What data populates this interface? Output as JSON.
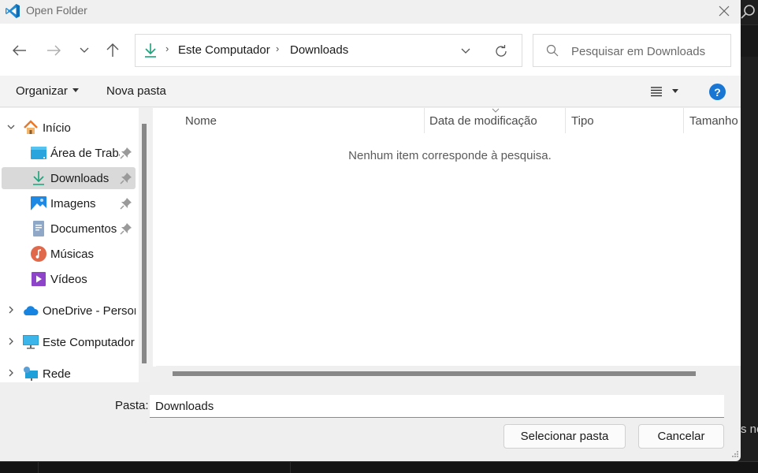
{
  "window": {
    "title": "Open Folder",
    "close_icon": "close-icon"
  },
  "navigation": {
    "back_icon": "arrow-left-icon",
    "forward_icon": "arrow-right-icon",
    "recent_icon": "chevron-down-icon",
    "up_icon": "arrow-up-icon",
    "breadcrumb": [
      {
        "label": "Este Computador"
      },
      {
        "label": "Downloads"
      }
    ],
    "breadcrumb_icon": "download-icon",
    "refresh_icon": "refresh-icon",
    "search_placeholder": "Pesquisar em Downloads",
    "search_value": ""
  },
  "commandbar": {
    "organize_label": "Organizar",
    "new_folder_label": "Nova pasta",
    "view_icon": "list-view-icon",
    "help_label": "?"
  },
  "sidebar": {
    "items": [
      {
        "label": "Início",
        "icon": "home-icon",
        "expanded": true,
        "level": 0
      },
      {
        "label": "Área de Trabalho",
        "icon": "desktop-icon",
        "pinned": true,
        "level": 1
      },
      {
        "label": "Downloads",
        "icon": "download-icon",
        "pinned": true,
        "selected": true,
        "level": 1
      },
      {
        "label": "Imagens",
        "icon": "pictures-icon",
        "pinned": true,
        "level": 1
      },
      {
        "label": "Documentos",
        "icon": "documents-icon",
        "pinned": true,
        "level": 1
      },
      {
        "label": "Músicas",
        "icon": "music-icon",
        "level": 1
      },
      {
        "label": "Vídeos",
        "icon": "videos-icon",
        "level": 1
      },
      {
        "label": "OneDrive - Personal",
        "icon": "onedrive-icon",
        "expanded": false,
        "level": 0
      },
      {
        "label": "Este Computador",
        "icon": "computer-icon",
        "expanded": false,
        "level": 0
      },
      {
        "label": "Rede",
        "icon": "network-icon",
        "expanded": false,
        "level": 0
      }
    ]
  },
  "file_list": {
    "columns": [
      {
        "label": "Nome"
      },
      {
        "label": "Data de modificação",
        "sorted": true
      },
      {
        "label": "Tipo"
      },
      {
        "label": "Tamanho"
      }
    ],
    "empty_message": "Nenhum item corresponde à pesquisa.",
    "rows": []
  },
  "footer": {
    "folder_label": "Pasta:",
    "folder_value": "Downloads",
    "select_button": "Selecionar pasta",
    "cancel_button": "Cancelar"
  },
  "background_app": {
    "partial_text": "s no"
  },
  "colors": {
    "accent": "#1976d2",
    "download_green": "#1aa37a",
    "selection": "#d9d9d9"
  }
}
